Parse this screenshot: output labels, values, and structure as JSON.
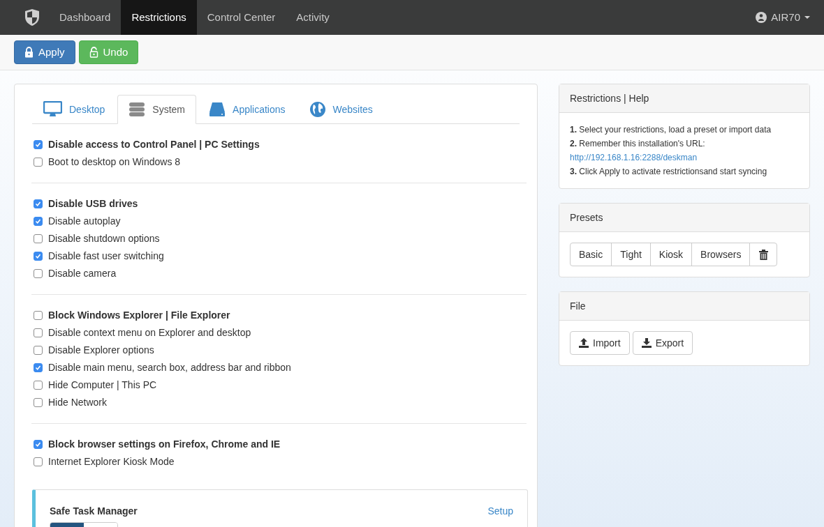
{
  "navbar": {
    "items": [
      {
        "label": "Dashboard",
        "selected": false
      },
      {
        "label": "Restrictions",
        "selected": true
      },
      {
        "label": "Control Center",
        "selected": false
      },
      {
        "label": "Activity",
        "selected": false
      }
    ],
    "user": "AIR70"
  },
  "toolbar": {
    "buttons": [
      {
        "label": "Apply",
        "kind": "primary"
      },
      {
        "label": "Undo",
        "kind": "success"
      }
    ]
  },
  "tabs": [
    {
      "label": "Desktop",
      "kind": "monitor",
      "selected": false
    },
    {
      "label": "System",
      "kind": "server",
      "selected": true
    },
    {
      "label": "Applications",
      "kind": "drive",
      "selected": false
    },
    {
      "label": "Websites",
      "kind": "globe",
      "selected": false
    }
  ],
  "groups": [
    {
      "heading": {
        "label": "Disable access to Control Panel | PC Settings",
        "checked": true
      },
      "options": [
        {
          "label": "Boot to desktop on Windows 8",
          "checked": false
        }
      ]
    },
    {
      "heading": {
        "label": "Disable USB drives",
        "checked": true
      },
      "options": [
        {
          "label": "Disable autoplay",
          "checked": true
        },
        {
          "label": "Disable shutdown options",
          "checked": false
        },
        {
          "label": "Disable fast user switching",
          "checked": true
        },
        {
          "label": "Disable camera",
          "checked": false
        }
      ]
    },
    {
      "heading": {
        "label": "Block Windows Explorer | File Explorer",
        "checked": false
      },
      "options": [
        {
          "label": "Disable context menu on Explorer and desktop",
          "checked": false
        },
        {
          "label": "Disable Explorer options",
          "checked": false
        },
        {
          "label": "Disable main menu, search box, address bar and ribbon",
          "checked": true
        },
        {
          "label": "Hide Computer | This PC",
          "checked": false
        },
        {
          "label": "Hide Network",
          "checked": false
        }
      ]
    },
    {
      "heading": {
        "label": "Block browser settings on Firefox, Chrome and IE",
        "checked": true
      },
      "options": [
        {
          "label": "Internet Explorer Kiosk Mode",
          "checked": false
        }
      ]
    }
  ],
  "safe_task_manager": {
    "title": "Safe Task Manager",
    "link": "Setup",
    "on": true
  },
  "help": {
    "title": "Restrictions | Help",
    "steps": [
      {
        "text": "**1.** Select your restrictions, load a preset or import data"
      },
      {
        "text": "**2.** Remember this installation's URL:",
        "link": "http://192.168.1.16:2288/deskman"
      },
      {
        "text": "**3.** Click Apply to activate restrictionsand start syncing"
      }
    ]
  },
  "presets": {
    "title": "Presets",
    "buttons": [
      "Basic",
      "Tight",
      "Kiosk",
      "Browsers"
    ]
  },
  "file": {
    "title": "File",
    "buttons": [
      {
        "label": "Import",
        "kind": "upload"
      },
      {
        "label": "Export",
        "kind": "download"
      }
    ]
  }
}
